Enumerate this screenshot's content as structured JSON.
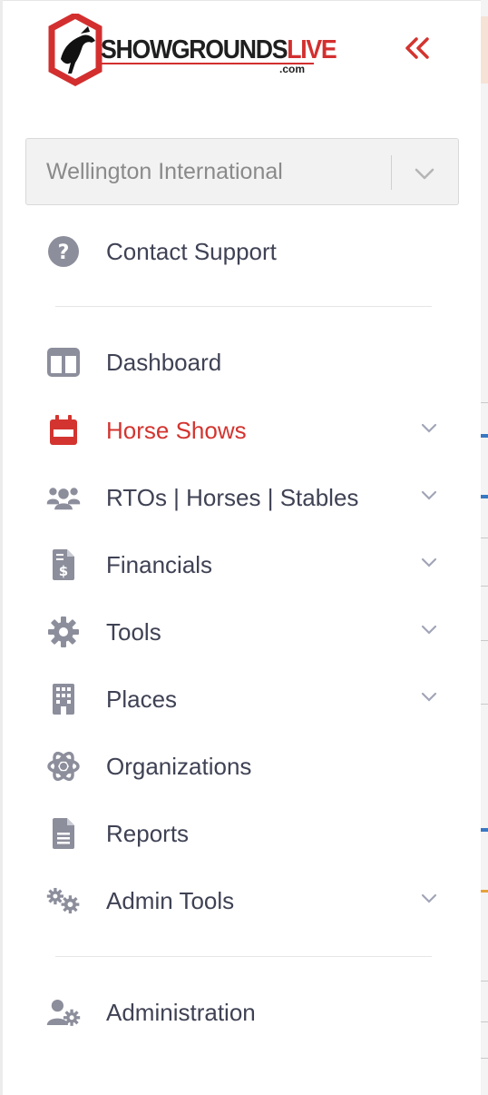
{
  "app": {
    "logo_text_main": "SHOWGROUNDS",
    "logo_text_accent": "LIVE",
    "logo_suffix": ".com"
  },
  "colors": {
    "accent": "#d3342f",
    "icon": "#8c8e9c",
    "text": "#3f4254"
  },
  "facility_select": {
    "value": "Wellington International"
  },
  "support": {
    "label": "Contact Support",
    "icon": "question-circle-icon"
  },
  "menu": [
    {
      "label": "Dashboard",
      "icon": "columns-icon",
      "expandable": false,
      "active": false
    },
    {
      "label": "Horse Shows",
      "icon": "calendar-icon",
      "expandable": true,
      "active": true
    },
    {
      "label": "RTOs | Horses | Stables",
      "icon": "users-icon",
      "expandable": true,
      "active": false
    },
    {
      "label": "Financials",
      "icon": "invoice-dollar-icon",
      "expandable": true,
      "active": false
    },
    {
      "label": "Tools",
      "icon": "gear-icon",
      "expandable": true,
      "active": false
    },
    {
      "label": "Places",
      "icon": "building-icon",
      "expandable": true,
      "active": false
    },
    {
      "label": "Organizations",
      "icon": "atom-icon",
      "expandable": false,
      "active": false
    },
    {
      "label": "Reports",
      "icon": "document-icon",
      "expandable": false,
      "active": false
    },
    {
      "label": "Admin Tools",
      "icon": "gears-icon",
      "expandable": true,
      "active": false
    }
  ],
  "administration": {
    "label": "Administration",
    "icon": "user-gear-icon"
  }
}
